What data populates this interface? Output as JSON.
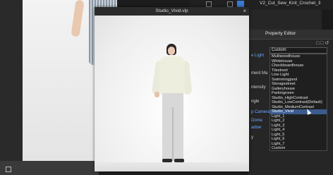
{
  "window": {
    "title": "Studio_Vivid.vlp",
    "close_glyph": "×"
  },
  "topbar": {
    "file_label": "V2_Cut_Sew_Knit_Crochet_3"
  },
  "property_editor": {
    "title": "Property Editor",
    "labels": [
      {
        "text": "e Light",
        "highlight": true
      },
      {
        "text": "ment Ma",
        "highlight": false
      },
      {
        "text": "ntensity",
        "highlight": false
      },
      {
        "text": "ngle",
        "highlight": false
      },
      {
        "text": "p Camera",
        "highlight": true
      },
      {
        "text": "Dome",
        "highlight": true
      },
      {
        "text": "adow",
        "highlight": true
      },
      {
        "text": "y",
        "highlight": false
      }
    ],
    "dropdown": {
      "selected_value": "Custom",
      "options": [
        "Multiwoodhouse",
        "Whitehouse",
        "Checkboardhouse",
        "Tilestreet",
        "Line Light",
        "Swimmingpool",
        "Storagestreet",
        "Galleryhouse",
        "Parkingroom",
        "Studio_HighContrast",
        "Studio_LowContrast(Default)",
        "Studio_MediumContrast",
        "Studio_Vivid",
        "Light_1",
        "Light_2",
        "Light_3",
        "Light_4",
        "Light_5",
        "Light_6",
        "Light_7",
        "Custom"
      ],
      "highlighted_option": "Studio_Vivid"
    }
  },
  "colors": {
    "accent_blue": "#3b5b8f",
    "label_highlight": "#6ea8ff"
  }
}
